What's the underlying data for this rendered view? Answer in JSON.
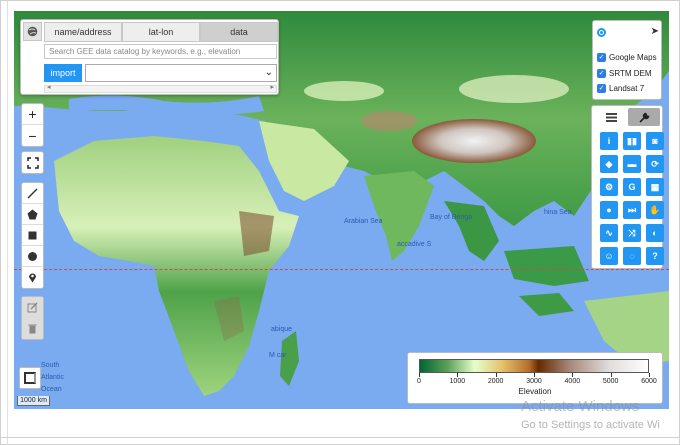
{
  "search_panel": {
    "tabs": [
      "name/address",
      "lat-lon",
      "data"
    ],
    "active_tab": "data",
    "search_placeholder": "Search GEE data catalog by keywords, e.g., elevation",
    "import_label": "import",
    "dataset_value": ""
  },
  "map_controls": {
    "zoom_in": "+",
    "zoom_out": "−"
  },
  "layers": {
    "items": [
      {
        "label": "Google Maps",
        "checked": true
      },
      {
        "label": "SRTM DEM",
        "checked": true
      },
      {
        "label": "Landsat 7",
        "checked": true
      }
    ]
  },
  "tools": {
    "grid": [
      [
        "info-icon",
        "chart-icon",
        "camera-icon"
      ],
      [
        "eraser-icon",
        "folder-icon",
        "refresh-icon"
      ],
      [
        "gears-icon",
        "google-icon",
        "map-icon"
      ],
      [
        "globe-icon",
        "fast-forward-icon",
        "hand-icon"
      ],
      [
        "line-chart-icon",
        "shuffle-icon",
        "contrast-icon"
      ],
      [
        "smile-icon",
        "spinner-icon",
        "help-icon"
      ]
    ],
    "grid_glyphs": [
      [
        "i",
        "▮▮",
        "◙"
      ],
      [
        "◆",
        "▬",
        "⟳"
      ],
      [
        "⚙",
        "G",
        "▦"
      ],
      [
        "●",
        "⏭",
        "✋"
      ],
      [
        "∿",
        "⤨",
        "◐"
      ],
      [
        "☺",
        "◌",
        "?"
      ]
    ]
  },
  "map_labels": {
    "arabian_sea": "Arabian Sea",
    "bay_of_bengal": "Bay of Benga",
    "china_sea": "hina Sea",
    "laccadive": "accadive S",
    "mozambique": "abique",
    "madagascar": "M  car",
    "south_atlantic_1": "South",
    "south_atlantic_2": "Atlantic",
    "south_atlantic_3": "Ocean"
  },
  "legend": {
    "ticks": [
      "0",
      "1000",
      "2000",
      "3000",
      "4000",
      "5000",
      "6000"
    ],
    "title": "Elevation",
    "colors": [
      "#006633",
      "#E5FFCC",
      "#662A00",
      "#D8D8D8",
      "#F5F5F5"
    ]
  },
  "scale": "1000 km",
  "watermark": {
    "title": "Activate Windows",
    "subtitle": "Go to Settings to activate Wi"
  }
}
